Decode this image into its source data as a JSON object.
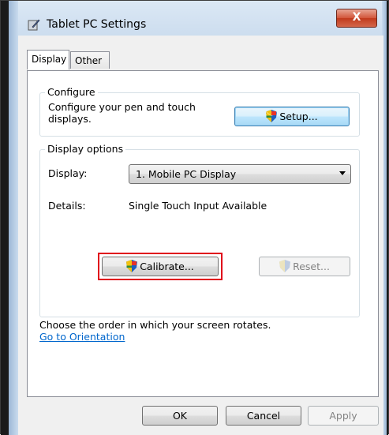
{
  "window": {
    "title": "Tablet PC Settings",
    "close_label": "X",
    "icon": "tablet-pen-icon"
  },
  "tabs": [
    {
      "label": "Display",
      "active": true
    },
    {
      "label": "Other",
      "active": false
    }
  ],
  "configure": {
    "group_label": "Configure",
    "description": "Configure your pen and touch displays.",
    "setup_label": "Setup..."
  },
  "display_options": {
    "group_label": "Display options",
    "display_label": "Display:",
    "display_value": "1. Mobile PC Display",
    "details_label": "Details:",
    "details_value": "Single Touch Input Available",
    "calibrate_label": "Calibrate...",
    "reset_label": "Reset..."
  },
  "orientation": {
    "text": "Choose the order in which your screen rotates.",
    "link_label": "Go to Orientation"
  },
  "footer": {
    "ok_label": "OK",
    "cancel_label": "Cancel",
    "apply_label": "Apply"
  },
  "colors": {
    "highlight": "#e0001a",
    "link": "#0066cc",
    "close_button": "#c13a1d"
  }
}
